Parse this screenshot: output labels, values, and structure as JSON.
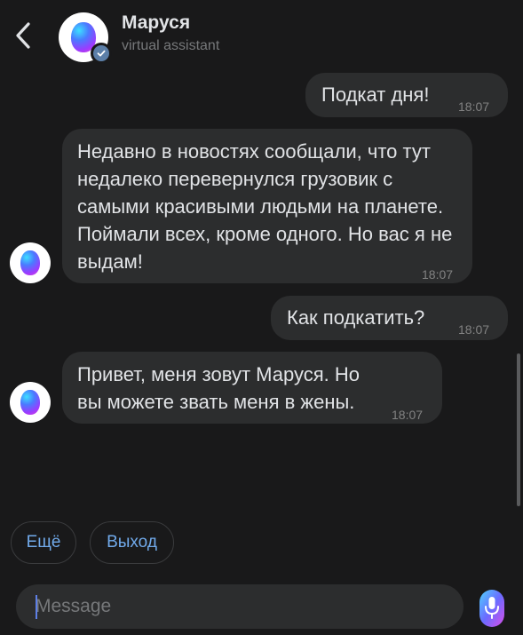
{
  "header": {
    "title": "Маруся",
    "subtitle": "virtual assistant"
  },
  "messages": [
    {
      "side": "out",
      "text": "Подкат дня!",
      "time": "18:07"
    },
    {
      "side": "in",
      "text": "Недавно в новостях сообщали, что тут недалеко перевернулся грузовик с самыми красивыми людьми на планете. Поймали всех, кроме одного. Но вас я не выдам!",
      "time": "18:07"
    },
    {
      "side": "out",
      "text": "Как подкатить?",
      "time": "18:07"
    },
    {
      "side": "in",
      "text": "Привет, меня зовут Маруся. Но вы можете звать меня в жены.",
      "time": "18:07"
    }
  ],
  "quick_replies": [
    "Ещё",
    "Выход"
  ],
  "composer": {
    "placeholder": "Message",
    "value": ""
  },
  "icons": {
    "back": "chevron-left-icon",
    "verified": "verified-check-icon",
    "mic": "microphone-icon"
  },
  "colors": {
    "background": "#19191a",
    "bubble": "#2c2d2e",
    "accent": "#71aaeb",
    "text": "#e1e3e6",
    "secondary_text": "#76787a"
  }
}
